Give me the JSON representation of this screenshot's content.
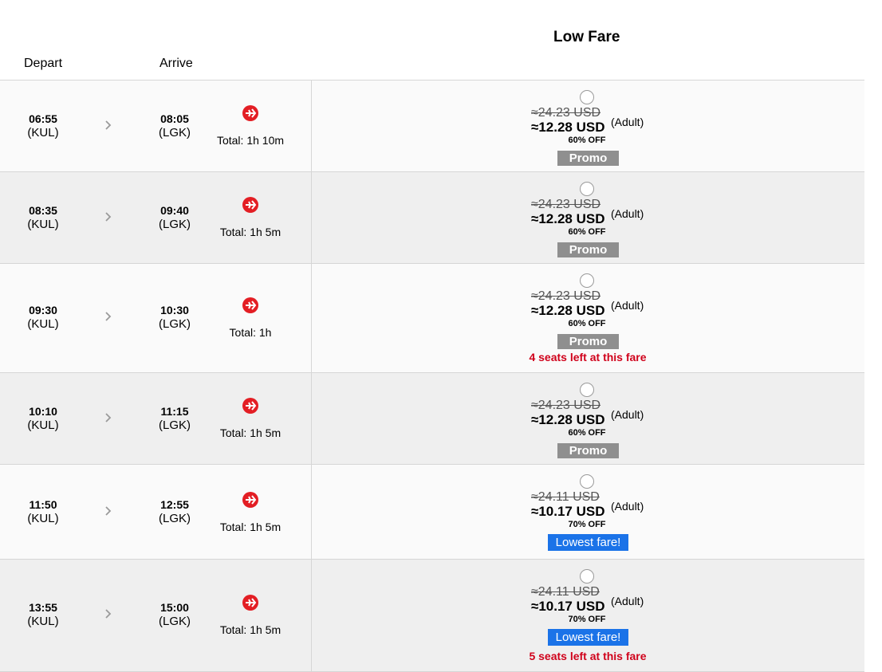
{
  "header": {
    "depart_label": "Depart",
    "arrive_label": "Arrive",
    "fare_label": "Low Fare"
  },
  "flights": [
    {
      "dep_time": "06:55",
      "dep_code": "(KUL)",
      "arr_time": "08:05",
      "arr_code": "(LGK)",
      "total": "Total: 1h 10m",
      "old_price": "≈24.23 USD",
      "new_price": "≈12.28 USD",
      "pax": "(Adult)",
      "discount": "60% OFF",
      "badge": "Promo",
      "seats": ""
    },
    {
      "dep_time": "08:35",
      "dep_code": "(KUL)",
      "arr_time": "09:40",
      "arr_code": "(LGK)",
      "total": "Total: 1h 5m",
      "old_price": "≈24.23 USD",
      "new_price": "≈12.28 USD",
      "pax": "(Adult)",
      "discount": "60% OFF",
      "badge": "Promo",
      "seats": ""
    },
    {
      "dep_time": "09:30",
      "dep_code": "(KUL)",
      "arr_time": "10:30",
      "arr_code": "(LGK)",
      "total": "Total: 1h",
      "old_price": "≈24.23 USD",
      "new_price": "≈12.28 USD",
      "pax": "(Adult)",
      "discount": "60% OFF",
      "badge": "Promo",
      "seats": "4 seats left at this fare"
    },
    {
      "dep_time": "10:10",
      "dep_code": "(KUL)",
      "arr_time": "11:15",
      "arr_code": "(LGK)",
      "total": "Total: 1h 5m",
      "old_price": "≈24.23 USD",
      "new_price": "≈12.28 USD",
      "pax": "(Adult)",
      "discount": "60% OFF",
      "badge": "Promo",
      "seats": ""
    },
    {
      "dep_time": "11:50",
      "dep_code": "(KUL)",
      "arr_time": "12:55",
      "arr_code": "(LGK)",
      "total": "Total: 1h 5m",
      "old_price": "≈24.11 USD",
      "new_price": "≈10.17 USD",
      "pax": "(Adult)",
      "discount": "70% OFF",
      "badge": "Lowest fare!",
      "seats": ""
    },
    {
      "dep_time": "13:55",
      "dep_code": "(KUL)",
      "arr_time": "15:00",
      "arr_code": "(LGK)",
      "total": "Total: 1h 5m",
      "old_price": "≈24.11 USD",
      "new_price": "≈10.17 USD",
      "pax": "(Adult)",
      "discount": "70% OFF",
      "badge": "Lowest fare!",
      "seats": "5 seats left at this fare"
    }
  ],
  "icons": {
    "chevron": "chevron-right-icon",
    "airline": "airline-plane-icon"
  },
  "colors": {
    "promo_badge": "#8f8f8f",
    "lowest_badge": "#1b73e8",
    "seats_warning": "#d0021b",
    "airline_red": "#e31e24"
  }
}
